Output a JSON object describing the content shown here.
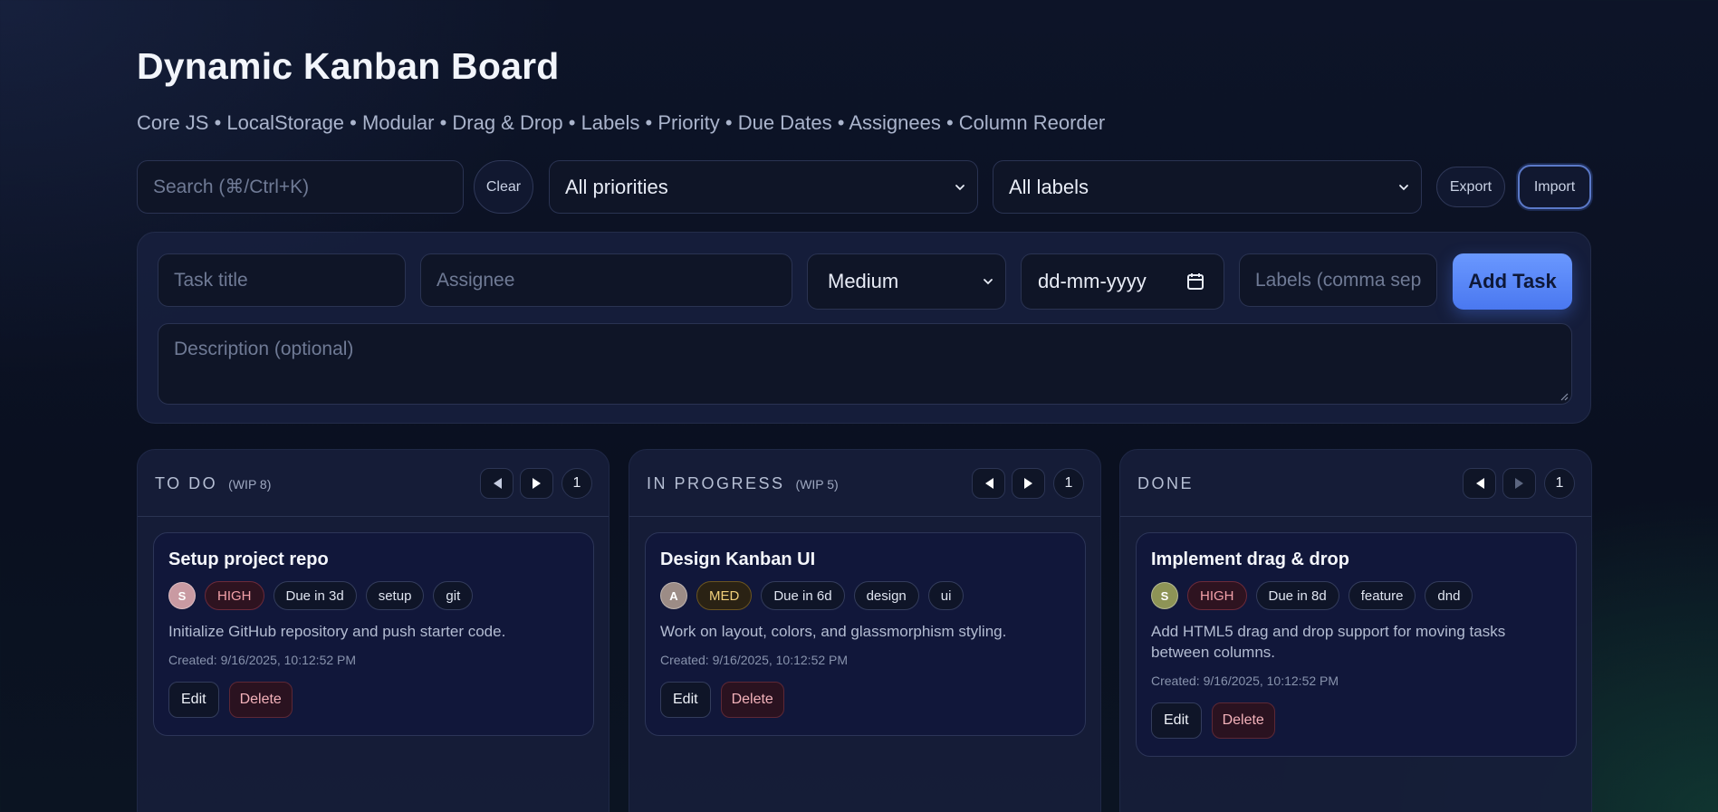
{
  "header": {
    "title": "Dynamic Kanban Board",
    "subtitle": "Core JS • LocalStorage • Modular • Drag & Drop • Labels • Priority • Due Dates • Assignees • Column Reorder"
  },
  "toolbar": {
    "search_placeholder": "Search (⌘/Ctrl+K)",
    "clear_label": "Clear",
    "priority_filter": "All priorities",
    "label_filter": "All labels",
    "export_label": "Export",
    "import_label": "Import"
  },
  "form": {
    "title_placeholder": "Task title",
    "assignee_placeholder": "Assignee",
    "priority_value": "Medium",
    "date_placeholder": "dd-mm-yyyy",
    "labels_placeholder": "Labels (comma sep",
    "add_label": "Add Task",
    "description_placeholder": "Description (optional)"
  },
  "columns": [
    {
      "title": "TO DO",
      "wip": "(WIP 8)",
      "count": "1",
      "card": {
        "title": "Setup project repo",
        "avatar": "S",
        "avatar_color": "#c99aa2",
        "priority": "HIGH",
        "due": "Due in 3d",
        "labels": [
          "setup",
          "git"
        ],
        "description": "Initialize GitHub repository and push starter code.",
        "created": "Created: 9/16/2025, 10:12:52 PM",
        "edit": "Edit",
        "delete": "Delete"
      }
    },
    {
      "title": "IN PROGRESS",
      "wip": "(WIP 5)",
      "count": "1",
      "card": {
        "title": "Design Kanban UI",
        "avatar": "A",
        "avatar_color": "#9c8c86",
        "priority": "MED",
        "due": "Due in 6d",
        "labels": [
          "design",
          "ui"
        ],
        "description": "Work on layout, colors, and glassmorphism styling.",
        "created": "Created: 9/16/2025, 10:12:52 PM",
        "edit": "Edit",
        "delete": "Delete"
      }
    },
    {
      "title": "DONE",
      "wip": "",
      "count": "1",
      "card": {
        "title": "Implement drag & drop",
        "avatar": "S",
        "avatar_color": "#8e9456",
        "priority": "HIGH",
        "due": "Due in 8d",
        "labels": [
          "feature",
          "dnd"
        ],
        "description": "Add HTML5 drag and drop support for moving tasks between columns.",
        "created": "Created: 9/16/2025, 10:12:52 PM",
        "edit": "Edit",
        "delete": "Delete"
      }
    }
  ]
}
